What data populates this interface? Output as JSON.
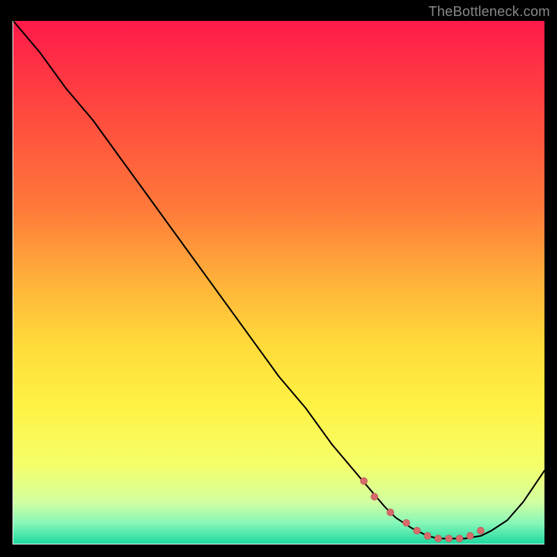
{
  "attribution": "TheBottleneck.com",
  "chart_data": {
    "type": "line",
    "title": "",
    "xlabel": "",
    "ylabel": "",
    "xlim": [
      0,
      100
    ],
    "ylim": [
      0,
      100
    ],
    "x": [
      0,
      5,
      10,
      15,
      20,
      25,
      30,
      35,
      40,
      45,
      50,
      55,
      60,
      65,
      70,
      72,
      75,
      78,
      80,
      82,
      85,
      88,
      90,
      93,
      96,
      100
    ],
    "y": [
      100,
      94,
      87,
      81,
      74,
      67,
      60,
      53,
      46,
      39,
      32,
      26,
      19,
      13,
      7,
      5,
      3,
      1.5,
      1,
      1,
      1,
      1.5,
      2.5,
      4.5,
      8,
      14
    ],
    "markers": {
      "x": [
        66,
        68,
        71,
        74,
        76,
        78,
        80,
        82,
        84,
        86,
        88
      ],
      "y": [
        12,
        9,
        6,
        4,
        2.5,
        1.5,
        1,
        1,
        1,
        1.5,
        2.5
      ]
    },
    "gradient_stops": [
      {
        "offset": 0.0,
        "color": "#ff1a4a"
      },
      {
        "offset": 0.18,
        "color": "#ff4a3e"
      },
      {
        "offset": 0.36,
        "color": "#ff7a3a"
      },
      {
        "offset": 0.5,
        "color": "#ffb23a"
      },
      {
        "offset": 0.62,
        "color": "#ffdb3a"
      },
      {
        "offset": 0.74,
        "color": "#fff245"
      },
      {
        "offset": 0.85,
        "color": "#f5ff6a"
      },
      {
        "offset": 0.92,
        "color": "#d2ffa0"
      },
      {
        "offset": 0.96,
        "color": "#87f7b8"
      },
      {
        "offset": 1.0,
        "color": "#1fd9a0"
      }
    ]
  }
}
